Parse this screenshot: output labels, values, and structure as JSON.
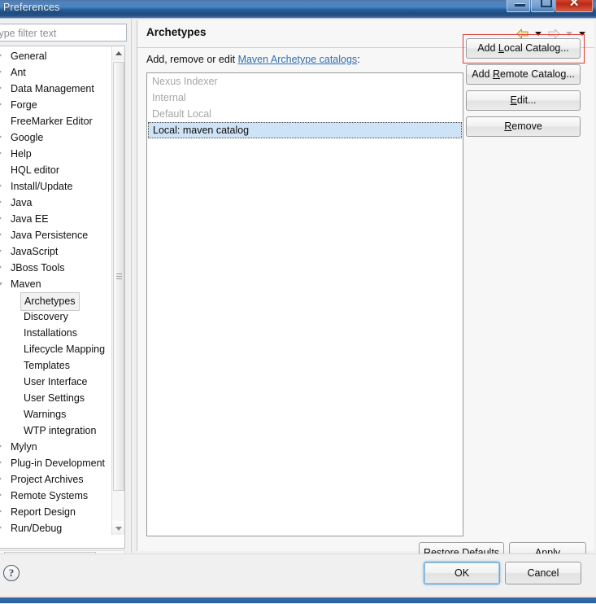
{
  "window": {
    "title": "Preferences",
    "controls": {
      "minimize": "minimize-button",
      "maximize": "maximize-button",
      "close_glyph": "✕"
    }
  },
  "sidebar": {
    "filter": {
      "placeholder": "type filter text",
      "value": ""
    },
    "items": [
      {
        "label": "General",
        "level": 0,
        "expandable": true,
        "expanded": false,
        "selected": false
      },
      {
        "label": "Ant",
        "level": 0,
        "expandable": true,
        "expanded": false,
        "selected": false
      },
      {
        "label": "Data Management",
        "level": 0,
        "expandable": true,
        "expanded": false,
        "selected": false
      },
      {
        "label": "Forge",
        "level": 0,
        "expandable": true,
        "expanded": false,
        "selected": false
      },
      {
        "label": "FreeMarker Editor",
        "level": 0,
        "expandable": false,
        "expanded": false,
        "selected": false
      },
      {
        "label": "Google",
        "level": 0,
        "expandable": true,
        "expanded": false,
        "selected": false
      },
      {
        "label": "Help",
        "level": 0,
        "expandable": true,
        "expanded": false,
        "selected": false
      },
      {
        "label": "HQL editor",
        "level": 0,
        "expandable": false,
        "expanded": false,
        "selected": false
      },
      {
        "label": "Install/Update",
        "level": 0,
        "expandable": true,
        "expanded": false,
        "selected": false
      },
      {
        "label": "Java",
        "level": 0,
        "expandable": true,
        "expanded": false,
        "selected": false
      },
      {
        "label": "Java EE",
        "level": 0,
        "expandable": true,
        "expanded": false,
        "selected": false
      },
      {
        "label": "Java Persistence",
        "level": 0,
        "expandable": true,
        "expanded": false,
        "selected": false
      },
      {
        "label": "JavaScript",
        "level": 0,
        "expandable": true,
        "expanded": false,
        "selected": false
      },
      {
        "label": "JBoss Tools",
        "level": 0,
        "expandable": true,
        "expanded": false,
        "selected": false
      },
      {
        "label": "Maven",
        "level": 0,
        "expandable": true,
        "expanded": true,
        "selected": false
      },
      {
        "label": "Archetypes",
        "level": 1,
        "expandable": false,
        "expanded": false,
        "selected": true
      },
      {
        "label": "Discovery",
        "level": 1,
        "expandable": false,
        "expanded": false,
        "selected": false
      },
      {
        "label": "Installations",
        "level": 1,
        "expandable": false,
        "expanded": false,
        "selected": false
      },
      {
        "label": "Lifecycle Mapping",
        "level": 1,
        "expandable": false,
        "expanded": false,
        "selected": false
      },
      {
        "label": "Templates",
        "level": 1,
        "expandable": false,
        "expanded": false,
        "selected": false
      },
      {
        "label": "User Interface",
        "level": 1,
        "expandable": false,
        "expanded": false,
        "selected": false
      },
      {
        "label": "User Settings",
        "level": 1,
        "expandable": false,
        "expanded": false,
        "selected": false
      },
      {
        "label": "Warnings",
        "level": 1,
        "expandable": false,
        "expanded": false,
        "selected": false
      },
      {
        "label": "WTP integration",
        "level": 1,
        "expandable": false,
        "expanded": false,
        "selected": false
      },
      {
        "label": "Mylyn",
        "level": 0,
        "expandable": true,
        "expanded": false,
        "selected": false
      },
      {
        "label": "Plug-in Development",
        "level": 0,
        "expandable": true,
        "expanded": false,
        "selected": false
      },
      {
        "label": "Project Archives",
        "level": 0,
        "expandable": true,
        "expanded": false,
        "selected": false
      },
      {
        "label": "Remote Systems",
        "level": 0,
        "expandable": true,
        "expanded": false,
        "selected": false
      },
      {
        "label": "Report Design",
        "level": 0,
        "expandable": true,
        "expanded": false,
        "selected": false
      },
      {
        "label": "Run/Debug",
        "level": 0,
        "expandable": true,
        "expanded": false,
        "selected": false
      }
    ]
  },
  "content": {
    "title": "Archetypes",
    "intro_prefix": "Add, remove or edit ",
    "intro_link": "Maven Archetype catalogs",
    "intro_suffix": ":",
    "nav": {
      "back_icon": "back-arrow-icon",
      "back_menu_icon": "chevron-down-icon",
      "forward_icon": "forward-arrow-icon",
      "forward_menu_icon": "chevron-down-icon",
      "view_menu_icon": "chevron-down-icon"
    },
    "catalogs": [
      {
        "label": "Nexus Indexer",
        "disabled": true,
        "selected": false
      },
      {
        "label": "Internal",
        "disabled": true,
        "selected": false
      },
      {
        "label": "Default Local",
        "disabled": true,
        "selected": false
      },
      {
        "label": "Local: maven catalog",
        "disabled": false,
        "selected": true
      }
    ],
    "buttons": {
      "add_local": {
        "pre": "Add ",
        "mn": "L",
        "post": "ocal Catalog..."
      },
      "add_remote": {
        "pre": "Add ",
        "mn": "R",
        "post": "emote Catalog..."
      },
      "edit": {
        "pre": "",
        "mn": "E",
        "post": "dit..."
      },
      "remove": {
        "pre": "",
        "mn": "R",
        "post": "emove"
      }
    },
    "page_buttons": {
      "restore_defaults": {
        "pre": "Restore ",
        "mn": "D",
        "post": "efaults"
      },
      "apply": {
        "pre": "",
        "mn": "A",
        "post": "pply"
      }
    }
  },
  "footer": {
    "help_glyph": "?",
    "ok_label": "OK",
    "cancel_label": "Cancel"
  },
  "annotation": {
    "highlight_target": "Add Local Catalog...",
    "color": "#e03a32"
  },
  "colors": {
    "title_bar_blue": "#2f6bb0",
    "selection_blue": "#cfe3f6",
    "link_blue": "#2f6fb5",
    "disabled_gray": "#a6a6a6",
    "annotation_red": "#e03a32",
    "close_red": "#d9452c"
  }
}
